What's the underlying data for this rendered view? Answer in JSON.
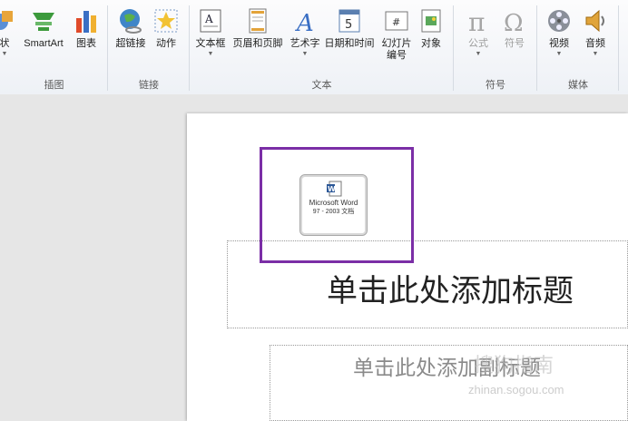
{
  "ribbon": {
    "groups": {
      "illustrations": {
        "label": "插图"
      },
      "links": {
        "label": "链接"
      },
      "text": {
        "label": "文本"
      },
      "symbols": {
        "label": "符号"
      },
      "media": {
        "label": "媒体"
      }
    },
    "buttons": {
      "shapes": "状",
      "smartart": "SmartArt",
      "chart": "图表",
      "hyperlink": "超链接",
      "action": "动作",
      "textbox": "文本框",
      "header_footer": "页眉和页脚",
      "wordart": "艺术字",
      "datetime": "日期和时间",
      "slide_number_l1": "幻灯片",
      "slide_number_l2": "编号",
      "object": "对象",
      "equation": "公式",
      "symbol": "符号",
      "video": "视频",
      "audio": "音频"
    }
  },
  "slide": {
    "embedded_object": {
      "line1": "Microsoft Word",
      "line2": "97 - 2003 文档"
    },
    "title_placeholder": "单击此处添加标题",
    "subtitle_placeholder": "单击此处添加副标题"
  },
  "watermark": {
    "line1": "搜狗指南",
    "line2": "zhinan.sogou.com"
  },
  "colors": {
    "highlight": "#7b2ea6"
  }
}
